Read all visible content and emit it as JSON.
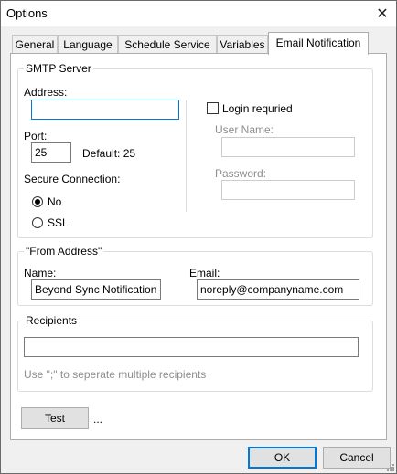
{
  "window": {
    "title": "Options",
    "close_glyph": "✕"
  },
  "tabs": [
    {
      "label": "General"
    },
    {
      "label": "Language"
    },
    {
      "label": "Schedule Service"
    },
    {
      "label": "Variables"
    },
    {
      "label": "Email Notification",
      "active": true
    }
  ],
  "smtp": {
    "legend": "SMTP Server",
    "address_label": "Address:",
    "address_value": "",
    "port_label": "Port:",
    "port_value": "25",
    "port_default": "Default: 25",
    "secure_label": "Secure Connection:",
    "radio_no": "No",
    "radio_ssl": "SSL",
    "secure_selected": "No",
    "login_label": "Login requried",
    "login_checked": false,
    "username_label": "User Name:",
    "username_value": "",
    "password_label": "Password:",
    "password_value": ""
  },
  "from": {
    "legend": "\"From Address\"",
    "name_label": "Name:",
    "name_value": "Beyond Sync Notification",
    "email_label": "Email:",
    "email_value": "noreply@companyname.com"
  },
  "recipients": {
    "legend": "Recipients",
    "value": "",
    "hint": "Use \";\" to seperate multiple recipients"
  },
  "actions": {
    "test_label": "Test",
    "test_status": "...",
    "ok_label": "OK",
    "cancel_label": "Cancel"
  },
  "colors": {
    "accent": "#0078d7",
    "disabled_text": "#8e8e8e"
  }
}
